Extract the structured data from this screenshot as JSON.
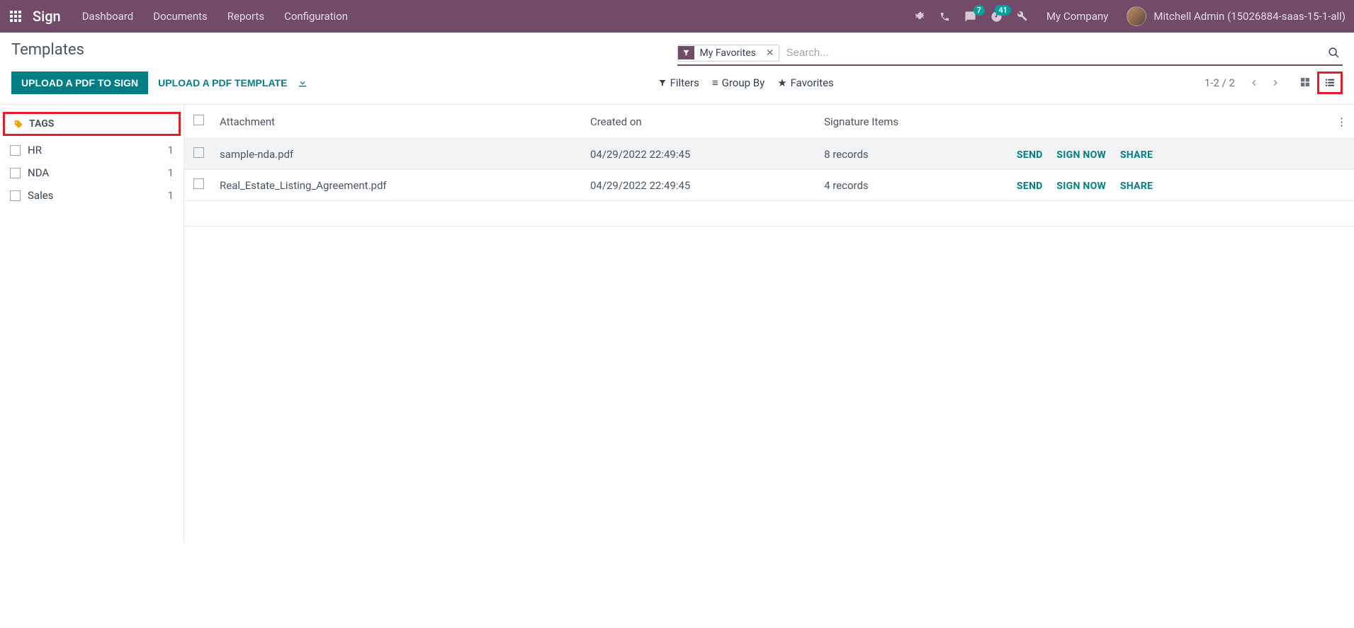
{
  "navbar": {
    "brand": "Sign",
    "items": [
      "Dashboard",
      "Documents",
      "Reports",
      "Configuration"
    ],
    "messages_badge": "7",
    "activities_badge": "41",
    "company": "My Company",
    "user_name": "Mitchell Admin (15026884-saas-15-1-all)"
  },
  "breadcrumb": "Templates",
  "search": {
    "facet_label": "My Favorites",
    "placeholder": "Search..."
  },
  "buttons": {
    "upload_sign": "UPLOAD A PDF TO SIGN",
    "upload_template": "UPLOAD A PDF TEMPLATE"
  },
  "toolbar": {
    "filters": "Filters",
    "group_by": "Group By",
    "favorites": "Favorites",
    "pager": "1-2 / 2"
  },
  "sidebar": {
    "header": "TAGS",
    "tags": [
      {
        "label": "HR",
        "count": "1"
      },
      {
        "label": "NDA",
        "count": "1"
      },
      {
        "label": "Sales",
        "count": "1"
      }
    ]
  },
  "table": {
    "headers": {
      "attachment": "Attachment",
      "created_on": "Created on",
      "signature_items": "Signature Items"
    },
    "rows": [
      {
        "attachment": "sample-nda.pdf",
        "created_on": "04/29/2022 22:49:45",
        "signature_items": "8 records"
      },
      {
        "attachment": "Real_Estate_Listing_Agreement.pdf",
        "created_on": "04/29/2022 22:49:45",
        "signature_items": "4 records"
      }
    ],
    "actions": {
      "send": "SEND",
      "sign_now": "SIGN NOW",
      "share": "SHARE"
    }
  }
}
